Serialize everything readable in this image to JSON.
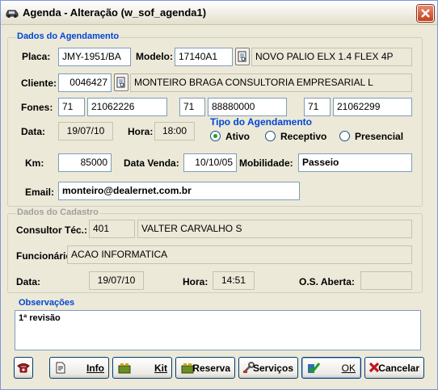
{
  "window": {
    "title": "Agenda - Alteração (w_sof_agenda1)"
  },
  "agendamento": {
    "section_title": "Dados do Agendamento",
    "placa_label": "Placa:",
    "placa": "JMY-1951/BA",
    "modelo_label": "Modelo:",
    "modelo_code": "17140A1",
    "modelo_desc": "NOVO PALIO ELX 1.4 FLEX 4P",
    "cliente_label": "Cliente:",
    "cliente_code": "0046427",
    "cliente_name": "MONTEIRO BRAGA CONSULTORIA EMPRESARIAL L",
    "fones_label": "Fones:",
    "fones": [
      {
        "ddd": "71",
        "numero": "21062226"
      },
      {
        "ddd": "71",
        "numero": "88880000"
      },
      {
        "ddd": "71",
        "numero": "21062299"
      }
    ],
    "data_label": "Data:",
    "data": "19/07/10",
    "hora_label": "Hora:",
    "hora": "18:00",
    "tipo_title": "Tipo do Agendamento",
    "tipo_options": [
      "Ativo",
      "Receptivo",
      "Presencial"
    ],
    "tipo_selected": "Ativo",
    "km_label": "Km:",
    "km": "85000",
    "data_venda_label": "Data Venda:",
    "data_venda": "10/10/05",
    "mobilidade_label": "Mobilidade:",
    "mobilidade": "Passeio",
    "email_label": "Email:",
    "email": "monteiro@dealernet.com.br"
  },
  "cadastro": {
    "section_title": "Dados do Cadastro",
    "consultor_label": "Consultor Téc.:",
    "consultor_code": "401",
    "consultor_name": "VALTER CARVALHO S",
    "funcionario_label": "Funcionário:",
    "funcionario": "ACAO INFORMATICA",
    "data_label": "Data:",
    "data": "19/07/10",
    "hora_label": "Hora:",
    "hora": "14:51",
    "os_label": "O.S. Aberta:",
    "os": ""
  },
  "observacoes": {
    "title": "Observações",
    "text": "1ª revisão"
  },
  "buttons": {
    "phone": "phone-icon",
    "info": "Info",
    "kit": "Kit",
    "reserva": "Reserva",
    "servicos": "Serviços",
    "ok": "OK",
    "cancelar": "Cancelar"
  }
}
